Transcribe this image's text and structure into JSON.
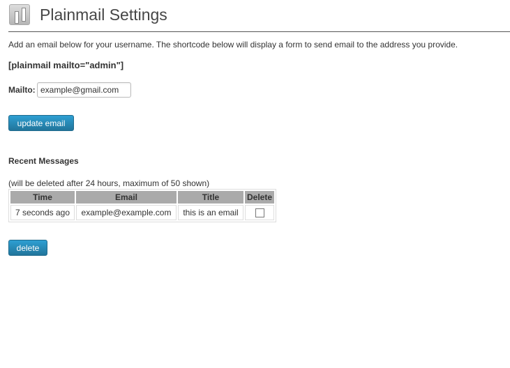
{
  "header": {
    "title": "Plainmail Settings",
    "icon": "settings-sliders-icon"
  },
  "intro": "Add an email below for your username. The shortcode below will display a form to send email to the address you provide.",
  "shortcode": "[plainmail mailto=\"admin\"]",
  "form": {
    "mailto_label": "Mailto:",
    "mailto_value": "example@gmail.com",
    "update_label": "update email"
  },
  "recent": {
    "heading": "Recent Messages",
    "note": "(will be deleted after 24 hours, maximum of 50 shown)",
    "columns": [
      "Time",
      "Email",
      "Title",
      "Delete"
    ],
    "rows": [
      {
        "time": "7 seconds ago",
        "email": "example@example.com",
        "title": "this is an email",
        "delete": false
      }
    ],
    "delete_label": "delete"
  },
  "colors": {
    "button": "#21759b",
    "header_cell": "#aaaaaa"
  }
}
